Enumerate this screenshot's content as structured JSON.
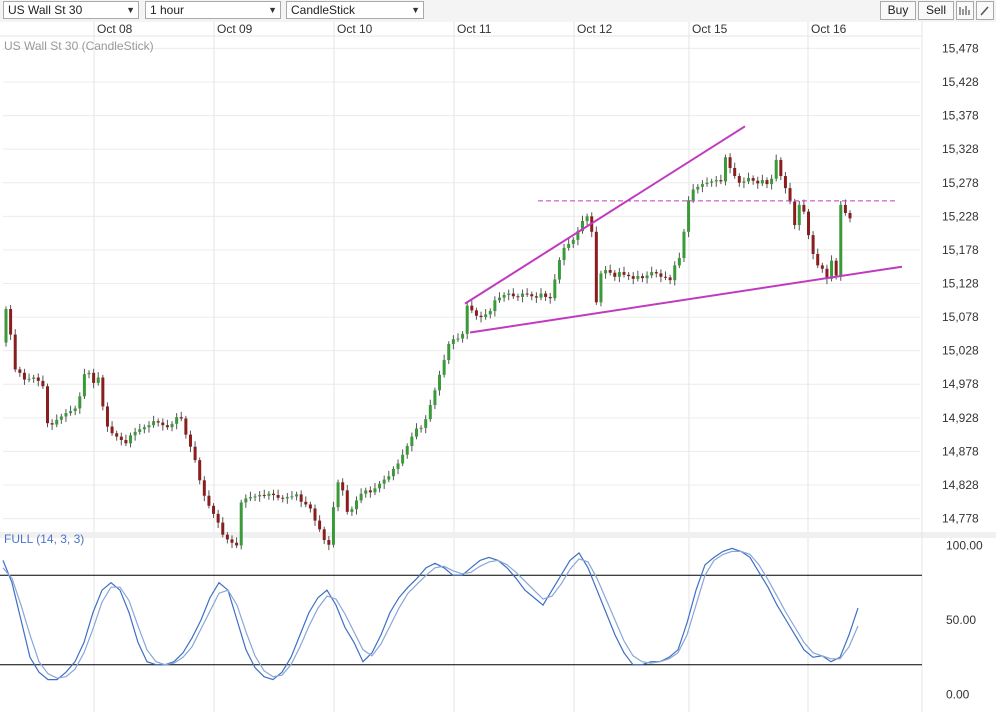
{
  "toolbar": {
    "instrument": "US Wall St 30",
    "timeframe": "1 hour",
    "chart_type": "CandleStick",
    "buy_label": "Buy",
    "sell_label": "Sell"
  },
  "chart_data": [
    {
      "type": "candlestick",
      "title": "US Wall St 30 (CandleStick)",
      "x_tick_labels": [
        "Oct 08",
        "Oct 09",
        "Oct 10",
        "Oct 11",
        "Oct 12",
        "Oct 15",
        "Oct 16"
      ],
      "y_tick_labels": [
        "15,478",
        "15,428",
        "15,378",
        "15,328",
        "15,278",
        "15,228",
        "15,178",
        "15,128",
        "15,078",
        "15,028",
        "14,978",
        "14,928",
        "14,878",
        "14,828",
        "14,778"
      ],
      "ylim": [
        14758,
        15498
      ],
      "grid": true,
      "colors": {
        "up": "#3a9a3a",
        "down": "#8a1e1e",
        "trendline": "#c03ac0"
      },
      "closes": [
        15090,
        15052,
        15000,
        14995,
        14985,
        14986,
        14988,
        14983,
        14975,
        14920,
        14918,
        14925,
        14930,
        14935,
        14938,
        14942,
        14960,
        14993,
        14995,
        14980,
        14988,
        14945,
        14915,
        14905,
        14900,
        14895,
        14890,
        14902,
        14907,
        14911,
        14914,
        14917,
        14923,
        14921,
        14917,
        14914,
        14919,
        14929,
        14927,
        14903,
        14885,
        14865,
        14835,
        14812,
        14797,
        14785,
        14772,
        14754,
        14747,
        14742,
        14738,
        14802,
        14808,
        14810,
        14811,
        14813,
        14812,
        14815,
        14813,
        14809,
        14808,
        14810,
        14811,
        14814,
        14803,
        14799,
        14793,
        14775,
        14762,
        14746,
        14739,
        14795,
        14832,
        14820,
        14788,
        14792,
        14805,
        14815,
        14820,
        14817,
        14823,
        14830,
        14836,
        14841,
        14852,
        14860,
        14873,
        14886,
        14900,
        14912,
        14913,
        14926,
        14947,
        14969,
        14992,
        15014,
        15038,
        15045,
        15046,
        15053,
        15095,
        15088,
        15080,
        15078,
        15082,
        15087,
        15103,
        15107,
        15111,
        15113,
        15109,
        15108,
        15113,
        15112,
        15109,
        15107,
        15113,
        15108,
        15106,
        15134,
        15163,
        15181,
        15187,
        15193,
        15206,
        15221,
        15228,
        15205,
        15100,
        15143,
        15148,
        15144,
        15138,
        15145,
        15141,
        15139,
        15135,
        15139,
        15136,
        15140,
        15145,
        15143,
        15138,
        15137,
        15133,
        15155,
        15166,
        15205,
        15252,
        15268,
        15272,
        15276,
        15278,
        15280,
        15282,
        15280,
        15316,
        15300,
        15288,
        15278,
        15280,
        15285,
        15281,
        15277,
        15282,
        15276,
        15284,
        15312,
        15288,
        15270,
        15250,
        15215,
        15245,
        15235,
        15200,
        15172,
        15155,
        15150,
        15135,
        15162,
        15140,
        15245,
        15233,
        15225
      ],
      "trendlines": [
        {
          "x": [
            15098,
            15362
          ]
        },
        {
          "x": [
            15055,
            15153
          ]
        }
      ],
      "resistance_level": 15251
    },
    {
      "type": "line",
      "title": "FULL (14, 3, 3)",
      "y_tick_labels": [
        "100.00",
        "50.00",
        "0.00"
      ],
      "ylim": [
        -5,
        105
      ],
      "reference_lines": [
        80,
        20
      ],
      "colors": {
        "k": "#3d6fc4",
        "d": "#8aa6d8"
      },
      "series": [
        {
          "values": [
            90,
            75,
            50,
            25,
            15,
            10,
            10,
            15,
            22,
            35,
            55,
            70,
            75,
            70,
            55,
            35,
            22,
            20,
            20,
            22,
            28,
            38,
            50,
            65,
            75,
            70,
            50,
            30,
            18,
            12,
            10,
            15,
            25,
            40,
            55,
            65,
            70,
            60,
            45,
            35,
            22,
            28,
            40,
            55,
            65,
            72,
            78,
            85,
            88,
            85,
            80,
            80,
            85,
            90,
            92,
            90,
            85,
            78,
            70,
            65,
            60,
            70,
            80,
            90,
            95,
            85,
            70,
            55,
            40,
            28,
            20,
            20,
            22,
            22,
            25,
            30,
            48,
            70,
            87,
            92,
            96,
            98,
            96,
            92,
            82,
            72,
            60,
            50,
            40,
            30,
            25,
            26,
            22,
            25,
            40,
            58
          ]
        },
        {
          "values": [
            85,
            78,
            60,
            40,
            22,
            14,
            11,
            12,
            17,
            28,
            44,
            62,
            72,
            72,
            63,
            46,
            30,
            22,
            20,
            21,
            25,
            32,
            44,
            56,
            68,
            70,
            60,
            42,
            26,
            16,
            12,
            13,
            20,
            32,
            46,
            58,
            66,
            64,
            54,
            42,
            30,
            26,
            34,
            46,
            58,
            68,
            74,
            80,
            85,
            86,
            83,
            81,
            82,
            86,
            89,
            90,
            87,
            82,
            76,
            70,
            64,
            66,
            74,
            84,
            91,
            89,
            78,
            64,
            50,
            36,
            26,
            22,
            21,
            22,
            24,
            28,
            40,
            60,
            80,
            90,
            94,
            96,
            96,
            94,
            87,
            77,
            66,
            55,
            45,
            35,
            28,
            26,
            24,
            24,
            32,
            46
          ]
        }
      ]
    }
  ]
}
